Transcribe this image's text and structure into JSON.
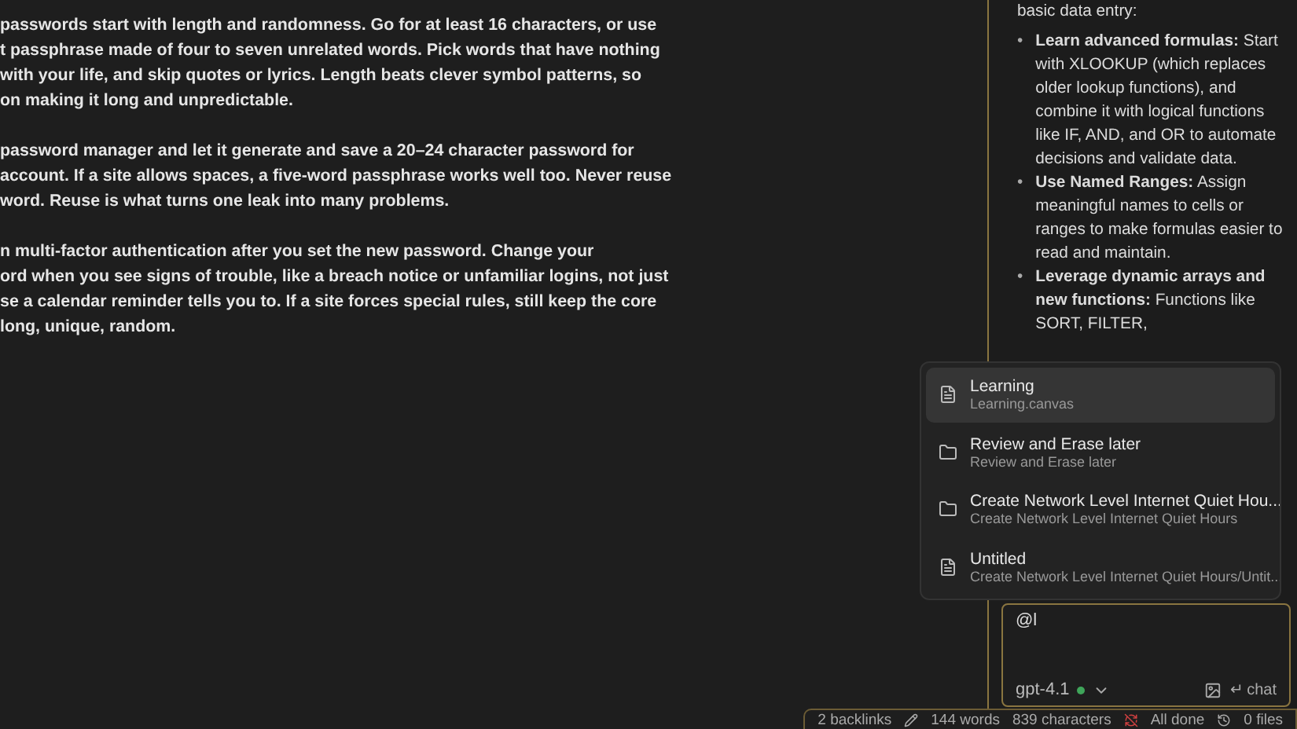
{
  "editor": {
    "paragraphs": [
      {
        "lines": [
          "passwords start with length and randomness. Go for at least 16 characters, or use",
          "t passphrase made of four to seven unrelated words. Pick words that have nothing",
          "with your life, and skip quotes or lyrics. Length beats clever symbol patterns, so",
          "on making it long and unpredictable."
        ]
      },
      {
        "lines": [
          "password manager and let it generate and save a 20–24 character password for",
          "account. If a site allows spaces, a five-word passphrase works well too. Never reuse",
          "word. Reuse is what turns one leak into many problems."
        ]
      },
      {
        "lines": [
          "n multi-factor authentication after you set the new password. Change your",
          "ord when you see signs of trouble, like a breach notice or unfamiliar logins, not just",
          "se a calendar reminder tells you to. If a site forces special rules, still keep the core",
          "long, unique, random."
        ]
      }
    ]
  },
  "chat": {
    "intro": "basic data entry:",
    "bullets": [
      {
        "marker": "•",
        "text": "**Learn advanced formulas:** Start with XLOOKUP (which replaces older lookup functions), and combine it with logical functions like IF, AND, and OR to automate decisions and validate data."
      },
      {
        "marker": "•",
        "text": "**Use Named Ranges:** Assign meaningful names to cells or ranges to make formulas easier to read and maintain."
      },
      {
        "marker": "•",
        "text": "**Leverage dynamic arrays and new functions:** Functions like SORT, FILTER,"
      }
    ],
    "input": {
      "value": "@l",
      "model": "gpt-4.1",
      "model_online": true,
      "send_label": "↵ chat"
    }
  },
  "suggestions": [
    {
      "kind": "file",
      "title": "Learning",
      "path": "Learning.canvas",
      "selected": true
    },
    {
      "kind": "folder",
      "title": "Review and Erase later",
      "path": "Review and Erase later",
      "selected": false
    },
    {
      "kind": "folder",
      "title": "Create Network Level Internet Quiet Hou...",
      "path": "Create Network Level Internet Quiet Hours",
      "selected": false
    },
    {
      "kind": "file",
      "title": "Untitled",
      "path": "Create Network Level Internet Quiet Hours/Untit...",
      "selected": false
    }
  ],
  "status_bar": {
    "backlinks": "2 backlinks",
    "words": "144 words",
    "characters": "839 characters",
    "sync": "All done",
    "files": "0 files"
  }
}
